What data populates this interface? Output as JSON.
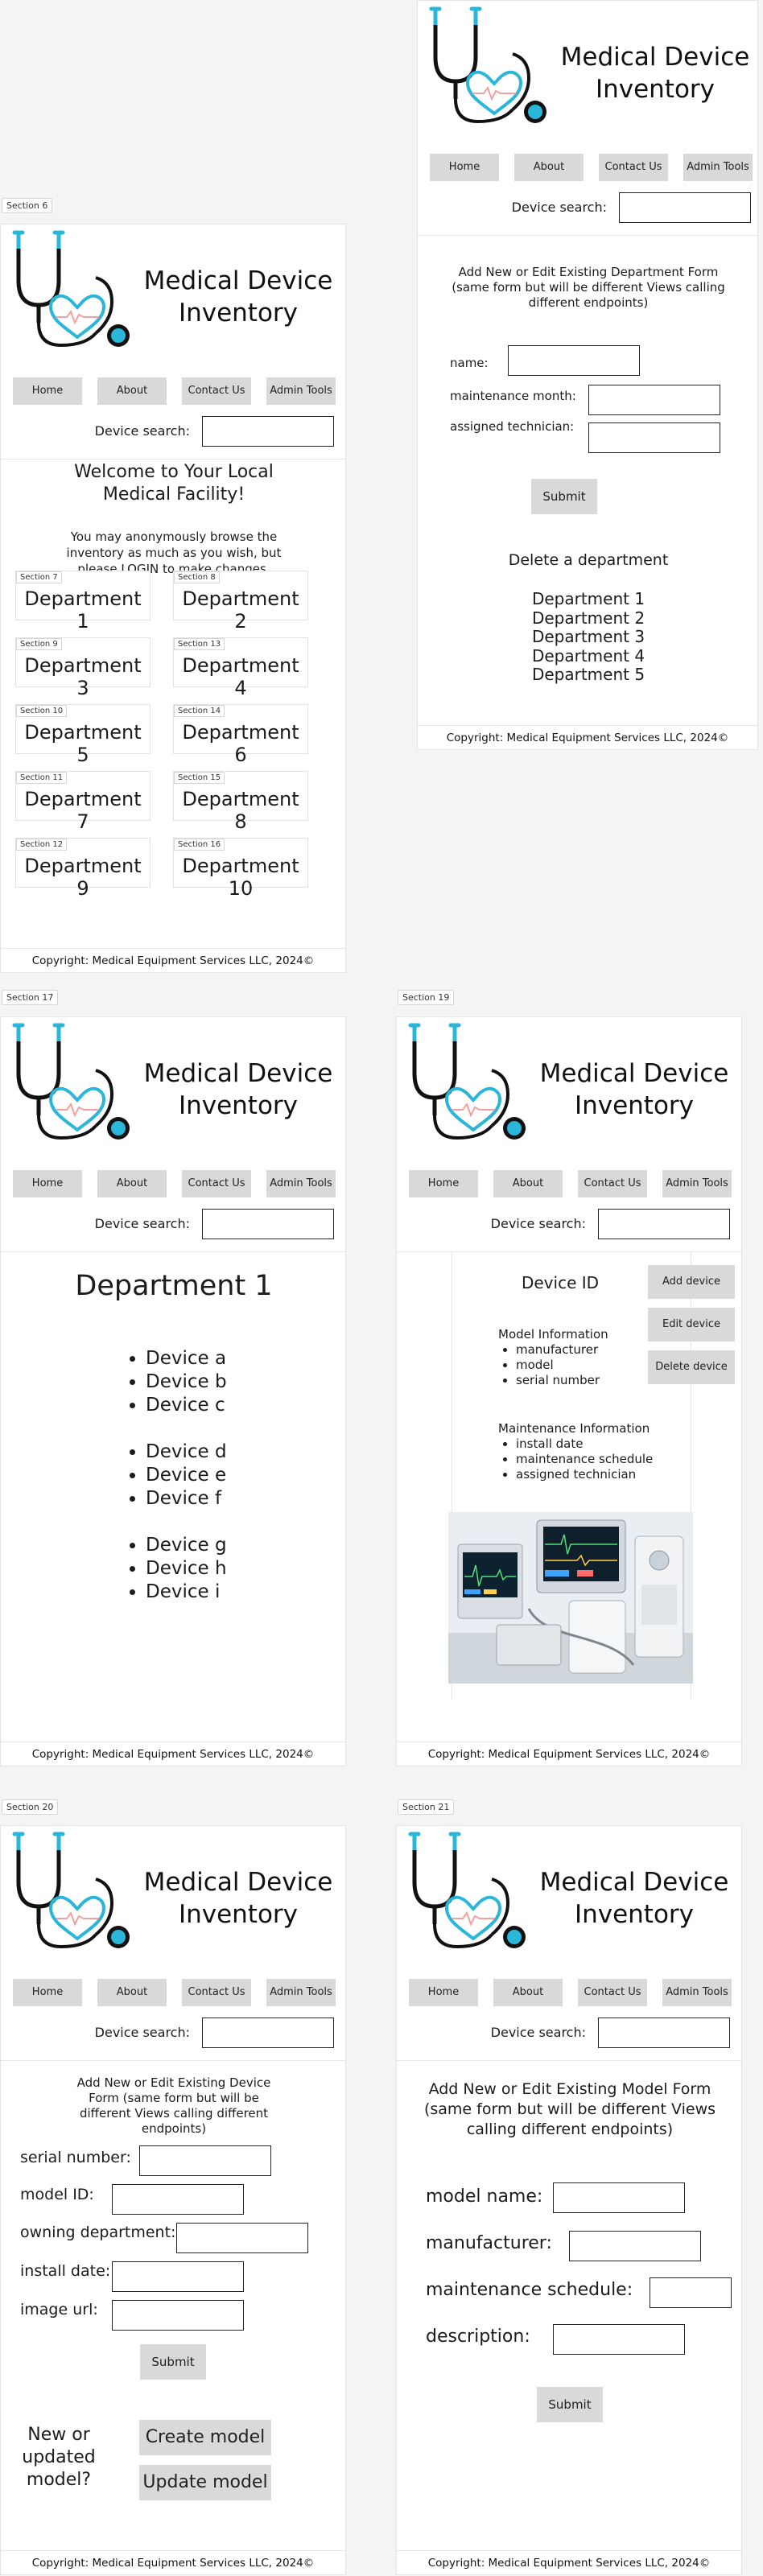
{
  "header": {
    "app_title": "Medical Device Inventory",
    "nav": [
      "Home",
      "About",
      "Contact Us",
      "Admin Tools"
    ],
    "search_label": "Device search:"
  },
  "footer": "Copyright: Medical Equipment Services LLC, 2024©",
  "colors": {
    "accent": "#29b6d8",
    "pulse": "#f2a1a1",
    "stethoscope": "#111111",
    "button": "#d9d9d9"
  },
  "icons": {
    "logo": "stethoscope-heart-icon"
  },
  "department_form": {
    "title": "Add New or Edit Existing Department Form (same form but will be different Views calling different endpoints)",
    "fields": [
      "name:",
      "maintenance month:",
      "assigned technician:"
    ],
    "submit": "Submit",
    "delete_title": "Delete a department",
    "departments": [
      "Department 1",
      "Department 2",
      "Department 3",
      "Department 4",
      "Department 5"
    ]
  },
  "home": {
    "section_label": "Section 6",
    "welcome": "Welcome to Your Local Medical Facility!",
    "intro": "You may anonymously browse the inventory as much as you wish, but please LOGIN to make changes.",
    "cards": [
      {
        "label": "Section 7",
        "name": "Department 1"
      },
      {
        "label": "Section 8",
        "name": "Department 2"
      },
      {
        "label": "Section 9",
        "name": "Department 3"
      },
      {
        "label": "Section 13",
        "name": "Department 4"
      },
      {
        "label": "Section 10",
        "name": "Department 5"
      },
      {
        "label": "Section 14",
        "name": "Department 6"
      },
      {
        "label": "Section 11",
        "name": "Department 7"
      },
      {
        "label": "Section 15",
        "name": "Department 8"
      },
      {
        "label": "Section 12",
        "name": "Department 9"
      },
      {
        "label": "Section 16",
        "name": "Department 10"
      }
    ]
  },
  "department_view": {
    "section_label": "Section 17",
    "title": "Department 1",
    "device_groups": [
      [
        "Device a",
        "Device b",
        "Device c"
      ],
      [
        "Device d",
        "Device e",
        "Device f"
      ],
      [
        "Device g",
        "Device h",
        "Device i"
      ]
    ]
  },
  "device_view": {
    "section_label": "Section 19",
    "title": "Device ID",
    "buttons": [
      "Add device",
      "Edit device",
      "Delete device"
    ],
    "model_heading": "Model Information",
    "model_items": [
      "manufacturer",
      "model",
      "serial number"
    ],
    "maint_heading": "Maintenance Information",
    "maint_items": [
      "install date",
      "maintenance schedule",
      "assigned technician"
    ]
  },
  "device_form": {
    "section_label": "Section 20",
    "title": "Add New or Edit Existing Device Form (same form but will be different Views calling different endpoints)",
    "fields": [
      "serial number:",
      "model ID:",
      "owning department:",
      "install date:",
      "image url:"
    ],
    "submit": "Submit",
    "model_question": "New or updated model?",
    "create_model": "Create model",
    "update_model": "Update model"
  },
  "model_form": {
    "section_label": "Section 21",
    "title": "Add New or Edit Existing Model Form (same form but will be different Views calling different endpoints)",
    "fields": [
      "model name:",
      "manufacturer:",
      "maintenance schedule:",
      "description:"
    ],
    "submit": "Submit"
  }
}
